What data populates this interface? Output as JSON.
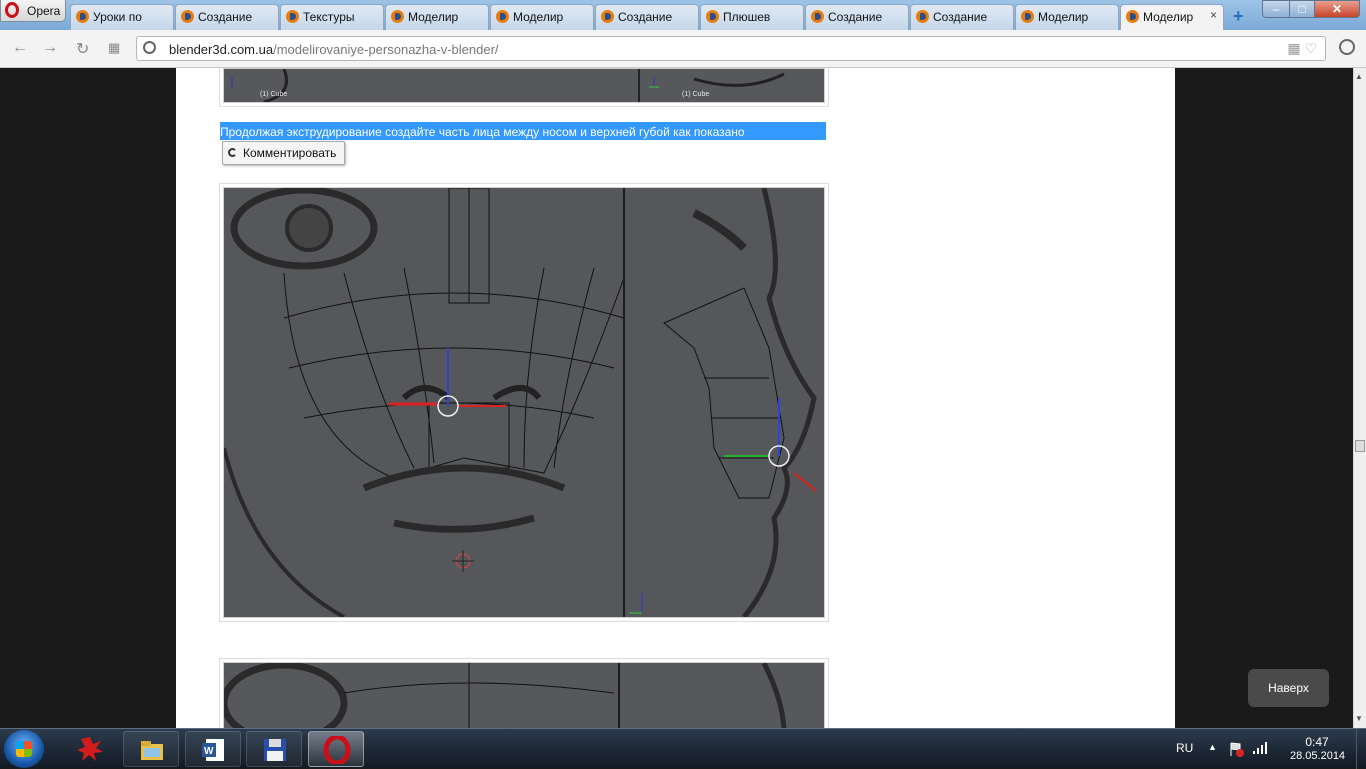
{
  "browser": {
    "opera_label": "Opera",
    "tabs": [
      {
        "label": "Уроки по"
      },
      {
        "label": "Создание"
      },
      {
        "label": "Текстуры"
      },
      {
        "label": "Моделир"
      },
      {
        "label": "Моделир"
      },
      {
        "label": "Создание"
      },
      {
        "label": "Плюшев"
      },
      {
        "label": "Создание"
      },
      {
        "label": "Создание"
      },
      {
        "label": "Моделир"
      },
      {
        "label": "Моделир",
        "active": true
      }
    ],
    "url_domain": "blender3d.com.ua",
    "url_path": "/modelirovaniye-personazha-v-blender/"
  },
  "article": {
    "top_image": {
      "left_label": "(1) Cube",
      "right_label": "(1) Cube"
    },
    "selected_text": "Продолжая экструдирование создайте часть лица между носом и верхней губой как показано",
    "comment_button": "Комментировать"
  },
  "page": {
    "back_to_top": "Наверх"
  },
  "taskbar": {
    "language": "RU",
    "time": "0:47",
    "date": "28.05.2014"
  }
}
